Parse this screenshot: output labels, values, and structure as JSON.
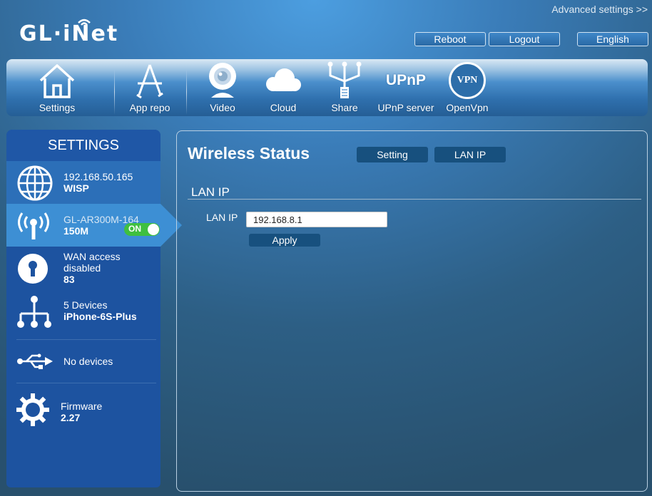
{
  "header": {
    "logo_text": "GL·iNet",
    "advanced_link": "Advanced settings >>",
    "buttons": {
      "reboot": "Reboot",
      "logout": "Logout",
      "language": "English"
    }
  },
  "toolbar": {
    "items": [
      {
        "label": "Settings",
        "icon": "home-icon"
      },
      {
        "label": "App repo",
        "icon": "app-store-icon"
      },
      {
        "label": "Video",
        "icon": "webcam-icon"
      },
      {
        "label": "Cloud",
        "icon": "cloud-icon"
      },
      {
        "label": "Share",
        "icon": "usb-share-icon"
      },
      {
        "label": "UPnP server",
        "icon": "upnp-icon",
        "icon_text": "UPnP"
      },
      {
        "label": "OpenVpn",
        "icon": "vpn-icon",
        "icon_text": "VPN"
      }
    ]
  },
  "sidebar": {
    "title": "SETTINGS",
    "items": [
      {
        "line1": "192.168.50.165",
        "line2": "WISP",
        "icon": "globe-icon"
      },
      {
        "line1": "GL-AR300M-164",
        "line2": "150M",
        "icon": "wifi-antenna-icon",
        "toggle": "ON"
      },
      {
        "line1": "WAN access",
        "line1b": "disabled",
        "line2": "83",
        "icon": "keyhole-icon"
      },
      {
        "line1": "5 Devices",
        "line2": "iPhone-6S-Plus",
        "icon": "network-tree-icon"
      },
      {
        "line1": "No devices",
        "icon": "usb-icon"
      },
      {
        "line1": "Firmware",
        "line2": "2.27",
        "icon": "gear-icon"
      }
    ]
  },
  "main": {
    "title": "Wireless Status",
    "tabs": {
      "setting": "Setting",
      "lan_ip": "LAN IP"
    },
    "section_title": "LAN IP",
    "lan_ip_label": "LAN IP",
    "lan_ip_value": "192.168.8.1",
    "apply_label": "Apply"
  },
  "colors": {
    "sidebar_bg": "#1d53a0",
    "sidebar_active": "#3d8fd4",
    "button_dark": "#17507e",
    "toggle_on": "#3fbf3f"
  }
}
